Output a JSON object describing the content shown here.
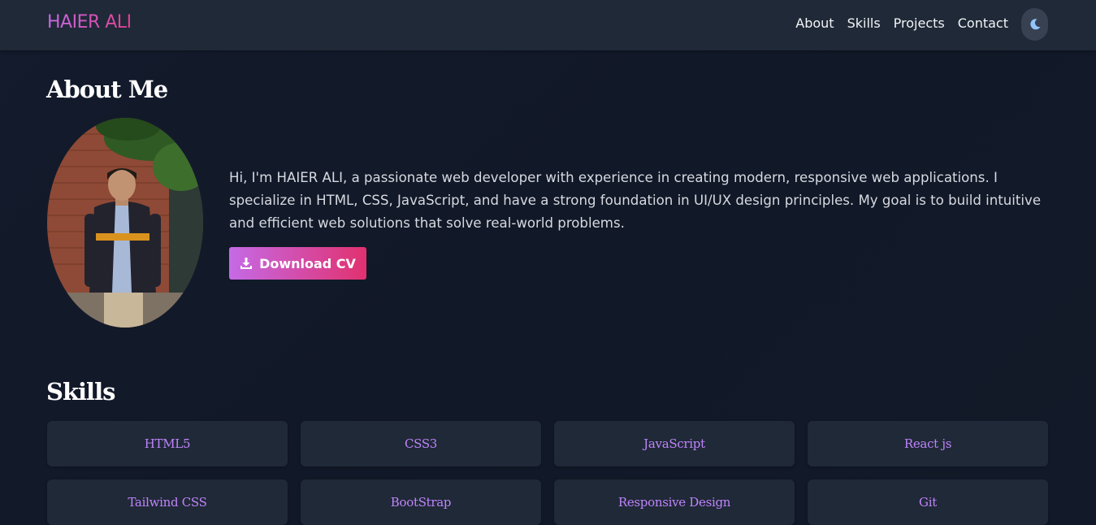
{
  "nav": {
    "logo": "HAIER ALI",
    "links": [
      "About",
      "Skills",
      "Projects",
      "Contact"
    ],
    "theme_toggle_icon": "moon-icon"
  },
  "about": {
    "title": "About Me",
    "bio": "Hi, I'm HAIER ALI, a passionate web developer with experience in creating modern, responsive web applications. I specialize in HTML, CSS, JavaScript, and have a strong foundation in UI/UX design principles. My goal is to build intuitive and efficient web solutions that solve real-world problems.",
    "cv_button": "Download CV",
    "cv_icon": "download-icon"
  },
  "skills": {
    "title": "Skills",
    "items": [
      "HTML5",
      "CSS3",
      "JavaScript",
      "React js",
      "Tailwind CSS",
      "BootStrap",
      "Responsive Design",
      "Git"
    ]
  },
  "colors": {
    "background": "#111827",
    "navbar": "#1f2937",
    "card": "#1f2937",
    "accent_start": "#c66ae8",
    "accent_end": "#e0408f",
    "skill_text": "#c084fc"
  }
}
